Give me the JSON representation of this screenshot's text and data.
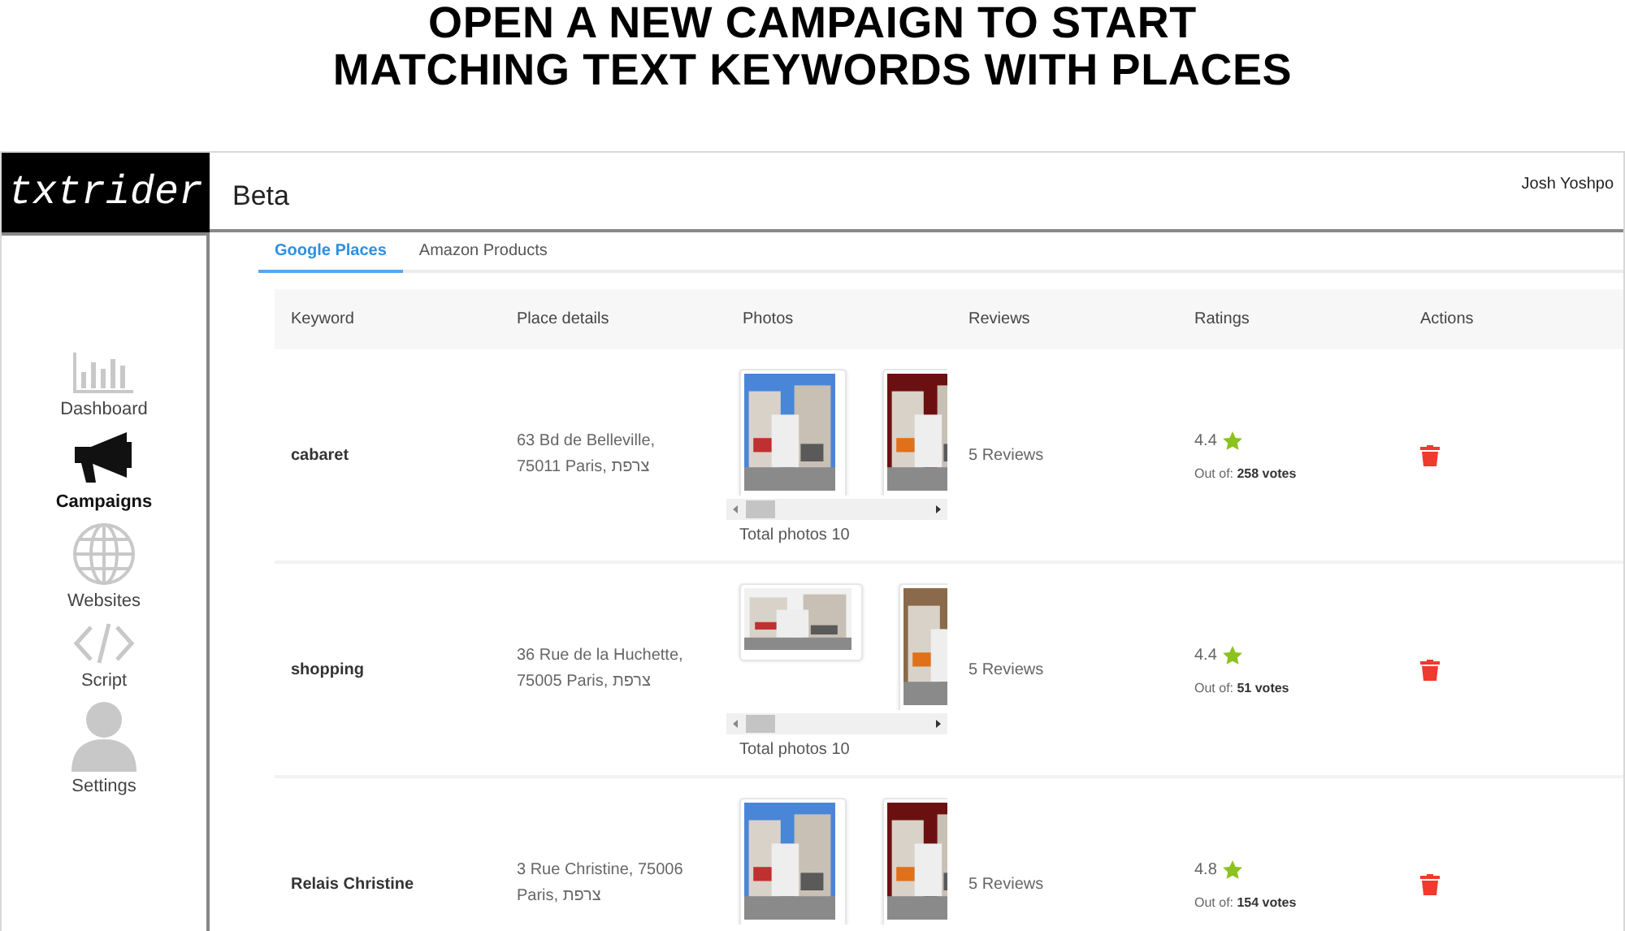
{
  "headline": [
    "OPEN A NEW CAMPAIGN TO START",
    "MATCHING TEXT KEYWORDS WITH PLACES"
  ],
  "header": {
    "logo": "txtrider",
    "title": "Beta",
    "user": "Josh Yoshpo"
  },
  "sidebar": {
    "items": [
      {
        "label": "Dashboard",
        "kind": "chart",
        "selected": false
      },
      {
        "label": "Campaigns",
        "kind": "megaphone",
        "selected": true
      },
      {
        "label": "Websites",
        "kind": "globe",
        "selected": false
      },
      {
        "label": "Script",
        "kind": "code",
        "selected": false
      },
      {
        "label": "Settings",
        "kind": "person",
        "selected": false
      }
    ]
  },
  "tabs": [
    {
      "label": "Google Places",
      "selected": true
    },
    {
      "label": "Amazon Products",
      "selected": false
    }
  ],
  "table": {
    "columns": [
      "Keyword",
      "Place details",
      "Photos",
      "Reviews",
      "Ratings",
      "Actions"
    ],
    "rows": [
      {
        "keyword": "cabaret",
        "place": [
          "63 Bd de Belleville,",
          "75011 Paris, צרפת"
        ],
        "photos": [
          {
            "kind": "picture",
            "landscape": false
          },
          {
            "kind": "picture",
            "landscape": false
          }
        ],
        "total_photos": "Total photos 10",
        "reviews": "5 Reviews",
        "rating": "4.4",
        "votes": "Out of: **258 votes**"
      },
      {
        "keyword": "shopping",
        "place": [
          "36 Rue de la Huchette,",
          "75005 Paris, צרפת"
        ],
        "photos": [
          {
            "kind": "picture",
            "landscape": true
          },
          {
            "kind": "picture",
            "landscape": false
          }
        ],
        "total_photos": "Total photos 10",
        "reviews": "5 Reviews",
        "rating": "4.4",
        "votes": "Out of: **51 votes**"
      },
      {
        "keyword": "Relais Christine",
        "place": [
          "3 Rue Christine, 75006",
          "Paris, צרפת"
        ],
        "photos": [
          {
            "kind": "picture",
            "landscape": false
          },
          {
            "kind": "picture",
            "landscape": false
          }
        ],
        "reviews": "5 Reviews",
        "rating": "4.8",
        "votes": "Out of: **154 votes**"
      }
    ]
  }
}
